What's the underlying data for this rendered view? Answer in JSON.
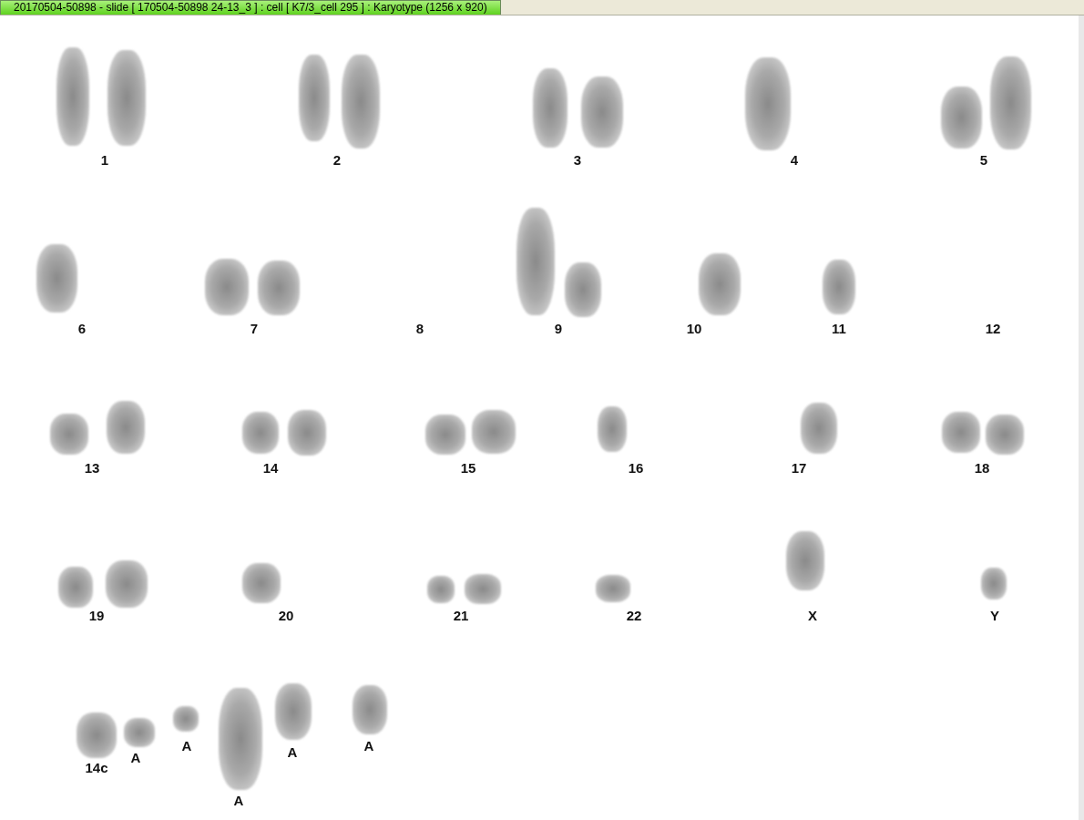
{
  "window": {
    "title": "20170504-50898 - slide [ 170504-50898 24-13_3 ] : cell [ K7/3_cell 295 ] : Karyotype  (1256 x 920)"
  },
  "karyotype": {
    "labels": [
      "1",
      "2",
      "3",
      "4",
      "5",
      "6",
      "7",
      "8",
      "9",
      "10",
      "11",
      "12",
      "13",
      "14",
      "15",
      "16",
      "17",
      "18",
      "19",
      "20",
      "21",
      "22",
      "X",
      "Y",
      "14c",
      "A",
      "A",
      "A",
      "A",
      "A"
    ]
  }
}
